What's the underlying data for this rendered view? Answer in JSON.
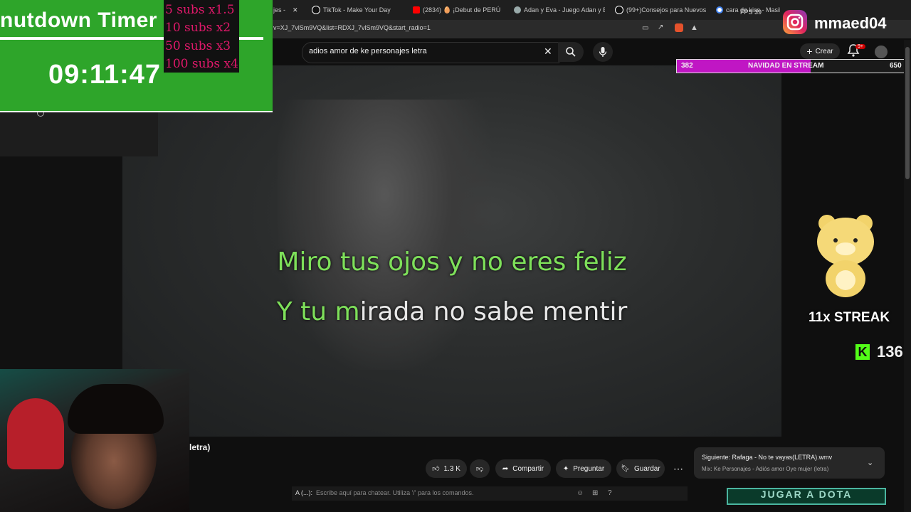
{
  "browser": {
    "tabs": [
      {
        "label": "jes - ",
        "color": "#888"
      },
      {
        "label": "TikTok - Make Your Day",
        "color": "#ffffff"
      },
      {
        "label": "(2834) 🥚 ¡Debut de PERÚ en",
        "color": "#ff0000"
      },
      {
        "label": "Adan y Eva - Juego Adan y Eva",
        "color": "#aaaaaa"
      },
      {
        "label": "(99+)Consejos para Nuevos St",
        "color": "#ffffff"
      },
      {
        "label": "cara de kiss - Masik",
        "color": "#4285f4"
      }
    ],
    "url": "v=XJ_7vlSm9VQ&list=RDXJ_7vlSm9VQ&start_radio=1"
  },
  "youtube": {
    "search_value": "adios amor de ke personajes letra",
    "create_label": "Crear",
    "notif_badge": "9+",
    "title_fragment": "letra)",
    "like_count": "1.3 K",
    "share_label": "Compartir",
    "ask_label": "Preguntar",
    "save_label": "Guardar",
    "next_title": "Siguiente: Rafaga - No te vayas(LETRA).wmv",
    "next_mix": "Mix: Ke Personajes - Adiós amor Oye mujer (letra)"
  },
  "video": {
    "lyric_line1": "Miro tus ojos y no eres feliz",
    "lyric_line2_sung": "Y tu m",
    "lyric_line2_rest": "irada no sabe mentir"
  },
  "overlay": {
    "timer_title": "nutdown Timer",
    "timer_value": "09:11:47",
    "subs": [
      "5 subs x1.5",
      "10 subs x2",
      "50 subs x3",
      "100 subs x4"
    ],
    "instagram_handle": "mmaed04",
    "fps_label": "FPS",
    "fps_value": "39",
    "goal_current": "382",
    "goal_label": "NAVIDAD EN STREAM",
    "goal_target": "650",
    "goal_progress": 0.588,
    "streak_label": "11x STREAK",
    "kick_count": "136",
    "chat_prefix": "A (...):",
    "chat_placeholder": "Escribe aquí para chatear. Utiliza '/' para los comandos.",
    "dota_label": "JUGAR A DOTA"
  }
}
